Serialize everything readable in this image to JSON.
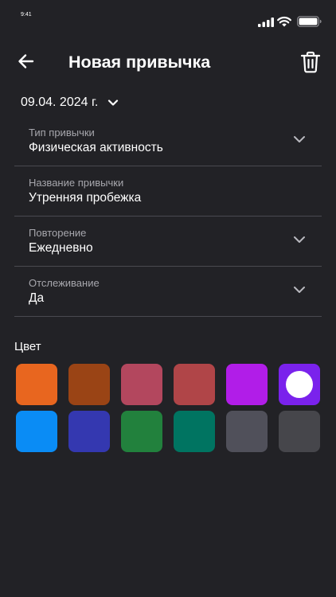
{
  "status_bar": {
    "time": "9:41",
    "icons": [
      "signal-icon",
      "wifi-icon",
      "battery-icon"
    ]
  },
  "header": {
    "title": "Новая привычка",
    "back_icon": "arrow-left-icon",
    "delete_icon": "trash-icon"
  },
  "date_selector": {
    "value": "09.04. 2024 г.",
    "icon": "chevron-down-icon"
  },
  "fields": {
    "habit_type": {
      "label": "Тип привычки",
      "value": "Физическая активность",
      "has_dropdown": true
    },
    "habit_name": {
      "label": "Название привычки",
      "value": "Утренняя пробежка",
      "has_dropdown": false
    },
    "repeat": {
      "label": "Повторение",
      "value": "Ежедневно",
      "has_dropdown": true
    },
    "tracking": {
      "label": "Отслеживание",
      "value": "Да",
      "has_dropdown": true
    }
  },
  "color_section": {
    "title": "Цвет",
    "selected_index": 5,
    "swatches": [
      "#e8661f",
      "#9a4415",
      "#b3475e",
      "#b04548",
      "#b11de8",
      "#7a22ec",
      "#0a8cf5",
      "#3438b0",
      "#22813d",
      "#007461",
      "#50505a",
      "#46464b"
    ]
  },
  "theme": {
    "background": "#222226",
    "divider": "#4a4a50",
    "label_color": "#a7a7ad",
    "text_color": "#ffffff"
  }
}
